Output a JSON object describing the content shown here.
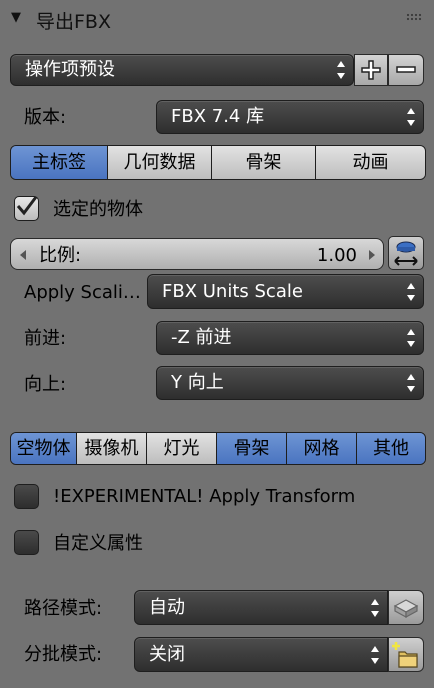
{
  "header": {
    "title": "导出FBX"
  },
  "preset": {
    "label": "操作项预设"
  },
  "version": {
    "label": "版本:",
    "value": "FBX 7.4 库"
  },
  "main_tabs": [
    {
      "label": "主标签",
      "active": true
    },
    {
      "label": "几何数据",
      "active": false
    },
    {
      "label": "骨架",
      "active": false
    },
    {
      "label": "动画",
      "active": false
    }
  ],
  "selected_objects": {
    "label": "选定的物体",
    "checked": true
  },
  "scale": {
    "label": "比例:",
    "value": "1.00"
  },
  "apply_scaling": {
    "label": "Apply Scali…",
    "value": "FBX Units Scale"
  },
  "forward": {
    "label": "前进:",
    "value": "-Z 前进"
  },
  "up": {
    "label": "向上:",
    "value": "Y 向上"
  },
  "object_types": [
    {
      "label": "空物体",
      "active": true
    },
    {
      "label": "摄像机",
      "active": false
    },
    {
      "label": "灯光",
      "active": false
    },
    {
      "label": "骨架",
      "active": true
    },
    {
      "label": "网格",
      "active": true
    },
    {
      "label": "其他",
      "active": true
    }
  ],
  "apply_transform": {
    "label": "!EXPERIMENTAL! Apply Transform",
    "checked": false
  },
  "custom_props": {
    "label": "自定义属性",
    "checked": false
  },
  "path_mode": {
    "label": "路径模式:",
    "value": "自动"
  },
  "batch_mode": {
    "label": "分批模式:",
    "value": "关闭"
  },
  "colors": {
    "accent": "#5a82c8",
    "panel": "#727272",
    "field": "#3a3a3a"
  }
}
